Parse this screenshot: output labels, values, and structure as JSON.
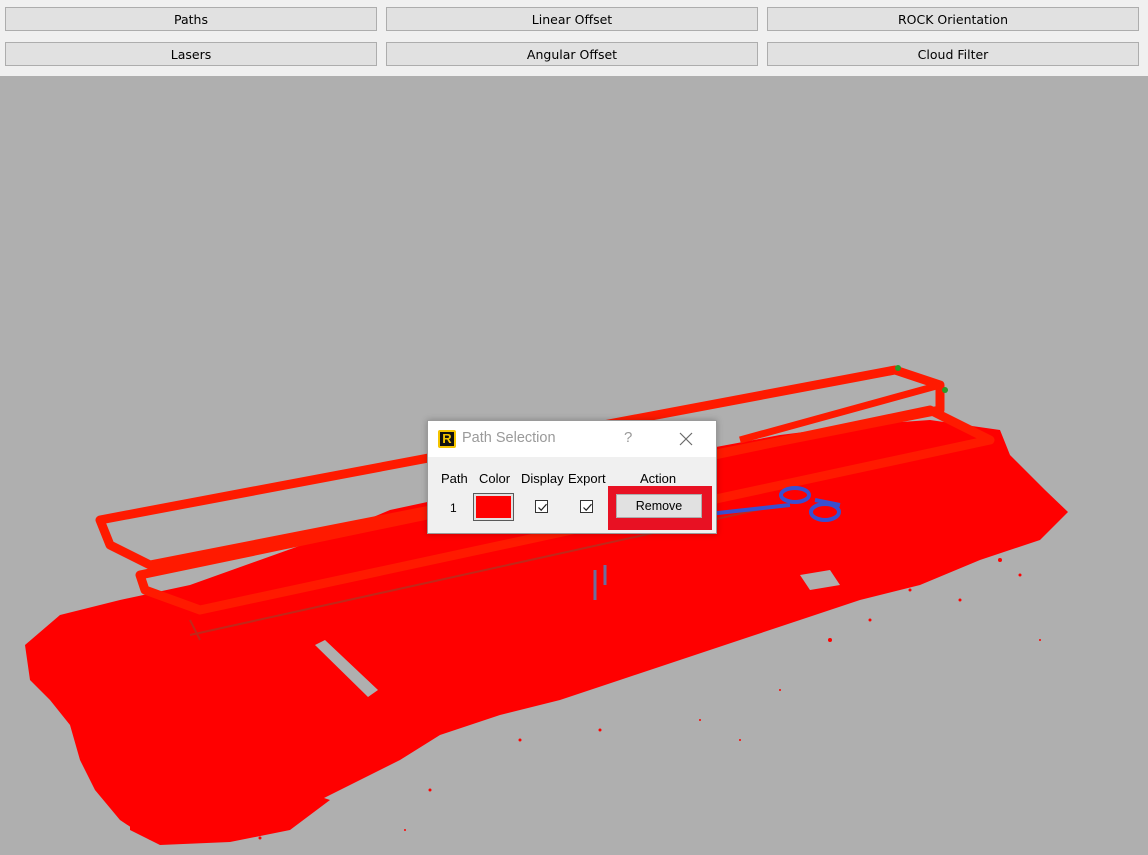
{
  "toolbar": {
    "row1": [
      "Paths",
      "Linear Offset",
      "ROCK Orientation"
    ],
    "row2": [
      "Lasers",
      "Angular Offset",
      "Cloud Filter"
    ]
  },
  "viewport": {
    "background_color": "#afafaf",
    "cloud_color": "#ff0000",
    "path_color": "#3a4fd0",
    "marker_color": "#2a9a2a"
  },
  "dialog": {
    "title": "Path Selection",
    "logo_letter": "R",
    "help_label": "?",
    "columns": {
      "path": "Path",
      "color": "Color",
      "display": "Display",
      "export": "Export",
      "action": "Action"
    },
    "rows": [
      {
        "path": "1",
        "color": "#ff0000",
        "display_checked": true,
        "export_checked": true,
        "action_label": "Remove"
      }
    ],
    "highlight_color": "#e81123"
  }
}
